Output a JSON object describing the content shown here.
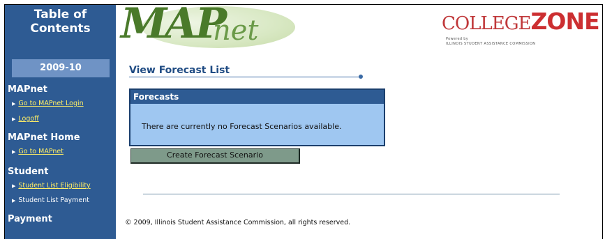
{
  "sidebar": {
    "toc_line1": "Table of",
    "toc_line2": "Contents",
    "year": "2009-10",
    "sections": [
      {
        "title": "MAPnet",
        "items": [
          {
            "label": "Go to MAPnet Login",
            "link": true
          },
          {
            "label": "Logoff",
            "link": true
          }
        ]
      },
      {
        "title": "MAPnet Home",
        "items": [
          {
            "label": "Go to MAPnet",
            "link": true
          }
        ]
      },
      {
        "title": "Student",
        "items": [
          {
            "label": "Student List Eligibility",
            "link": true
          },
          {
            "label": "Student List Payment",
            "link": false
          }
        ]
      },
      {
        "title": "Payment",
        "items": []
      }
    ]
  },
  "header": {
    "logo_main": "MAP",
    "logo_net": "net",
    "collegezone_prefix": "COLLEGE",
    "collegezone_zone": "ZONE",
    "collegezone_powered": "Powered by",
    "collegezone_org": "ILLINOIS STUDENT ASSISTANCE COMMISSION"
  },
  "main": {
    "page_title": "View Forecast List",
    "panel_title": "Forecasts",
    "panel_message": "There are currently no Forecast Scenarios available.",
    "create_button": "Create Forecast Scenario"
  },
  "footer": {
    "copyright": "© 2009, Illinois Student Assistance Commission, all rights reserved."
  },
  "colors": {
    "sidebar_bg": "#2e5b93",
    "year_bar": "#6f93c5",
    "link": "#ffee66",
    "panel_bg": "#9fc7f1",
    "button_bg": "#7e9a8a"
  }
}
